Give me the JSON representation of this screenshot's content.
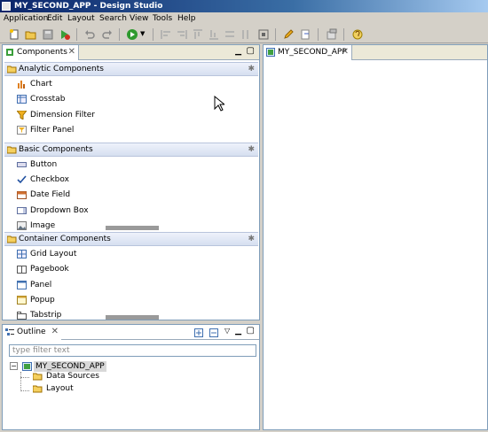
{
  "window": {
    "title": "MY_SECOND_APP - Design Studio"
  },
  "menu": [
    "Application",
    "Edit",
    "Layout",
    "Search",
    "View",
    "Tools",
    "Help"
  ],
  "components_view": {
    "tab_label": "Components",
    "categories": [
      {
        "label": "Analytic Components",
        "items": [
          "Chart",
          "Crosstab",
          "Dimension Filter",
          "Filter Panel"
        ]
      },
      {
        "label": "Basic Components",
        "items": [
          "Button",
          "Checkbox",
          "Date Field",
          "Dropdown Box",
          "Image"
        ]
      },
      {
        "label": "Container Components",
        "items": [
          "Grid Layout",
          "Pagebook",
          "Panel",
          "Popup",
          "Tabstrip"
        ]
      }
    ]
  },
  "outline_view": {
    "tab_label": "Outline",
    "filter_placeholder": "type filter text",
    "tree": {
      "root": "MY_SECOND_APP",
      "children": [
        "Data Sources",
        "Layout"
      ]
    }
  },
  "editor": {
    "tab_label": "MY_SECOND_APP"
  }
}
